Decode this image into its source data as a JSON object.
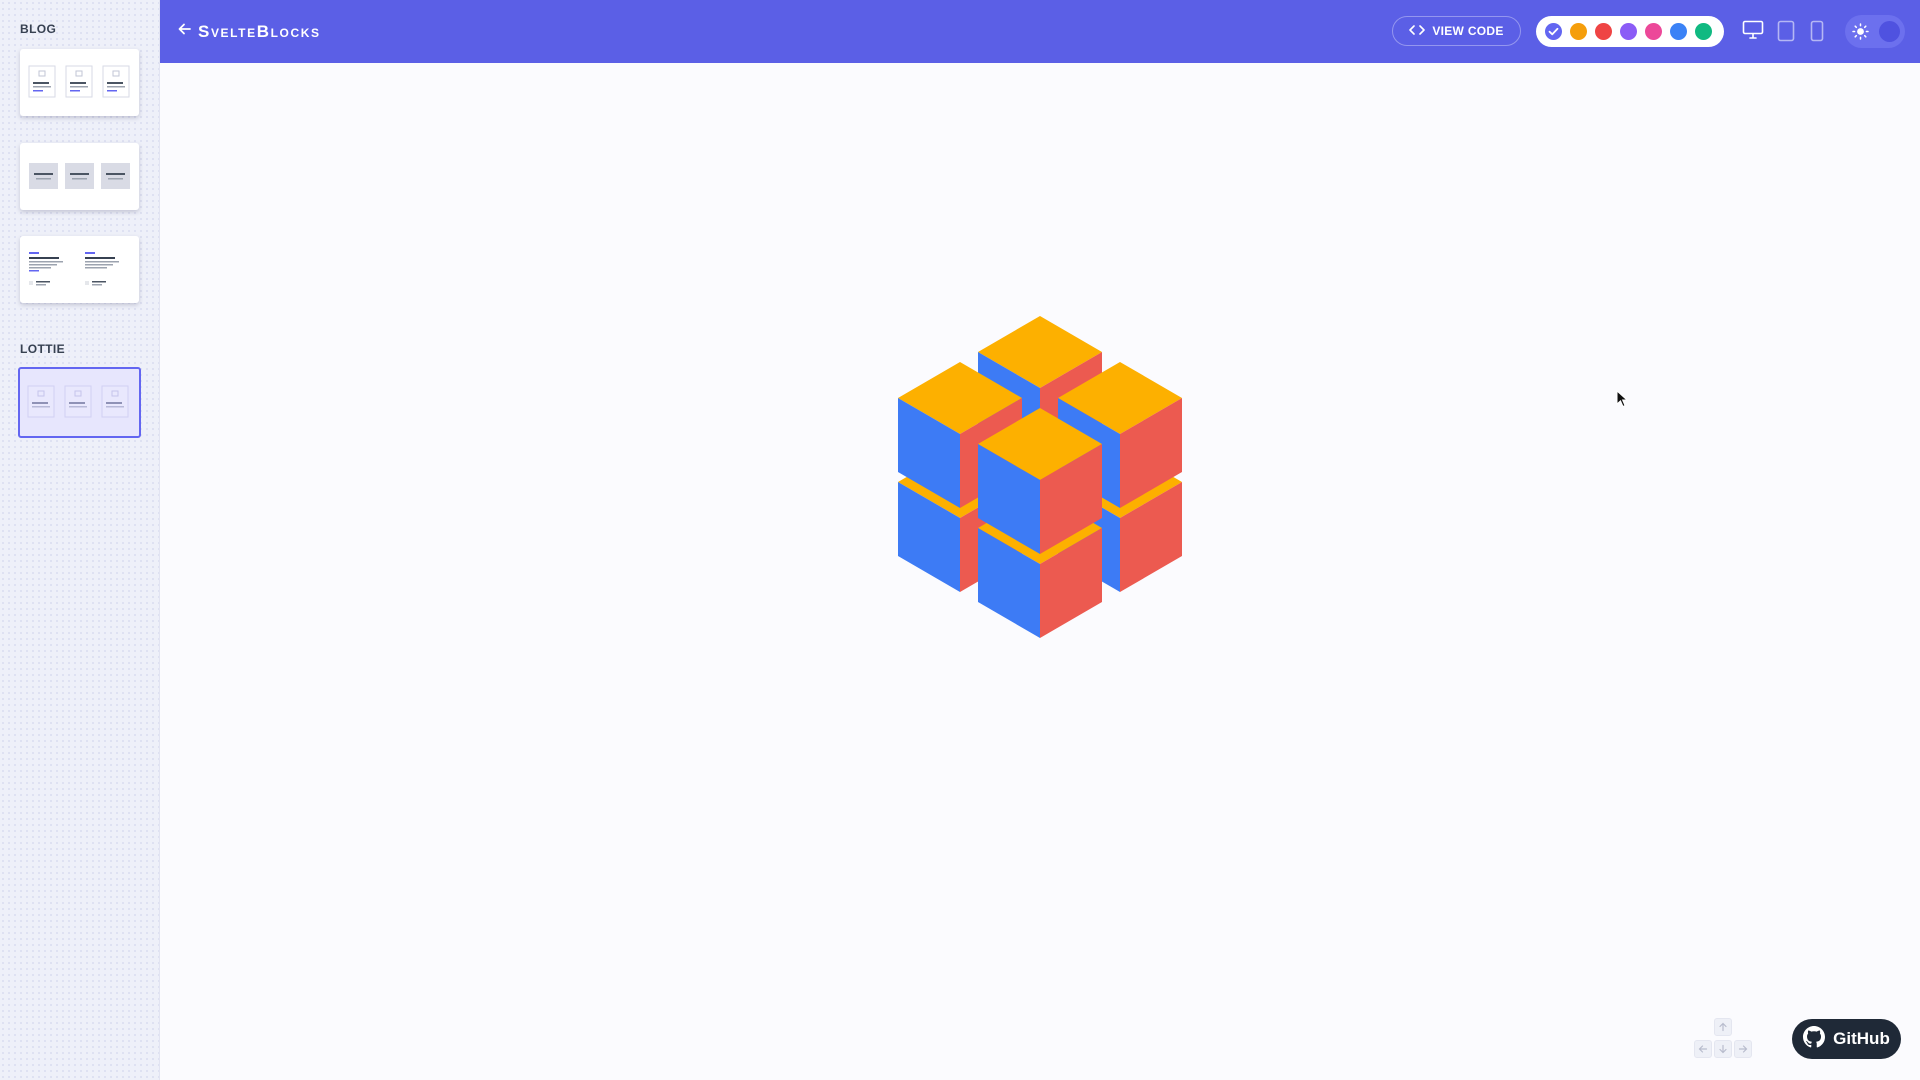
{
  "header": {
    "brand": "SvelteBlocks",
    "view_code_label": "VIEW CODE",
    "colors": [
      "#6366f1",
      "#f59e0b",
      "#ef4444",
      "#8b5cf6",
      "#ec4899",
      "#3b82f6",
      "#10b981"
    ],
    "selected_color": "#6366f1",
    "background": "#5b5fe6"
  },
  "sidebar": {
    "sections": [
      {
        "title": "BLOG"
      },
      {
        "title": "LOTTIE"
      }
    ]
  },
  "main": {
    "cube_colors": {
      "top": "#FDB000",
      "left": "#3D7BF5",
      "right": "#EC5A50"
    }
  },
  "footer": {
    "github_label": "GitHub"
  }
}
